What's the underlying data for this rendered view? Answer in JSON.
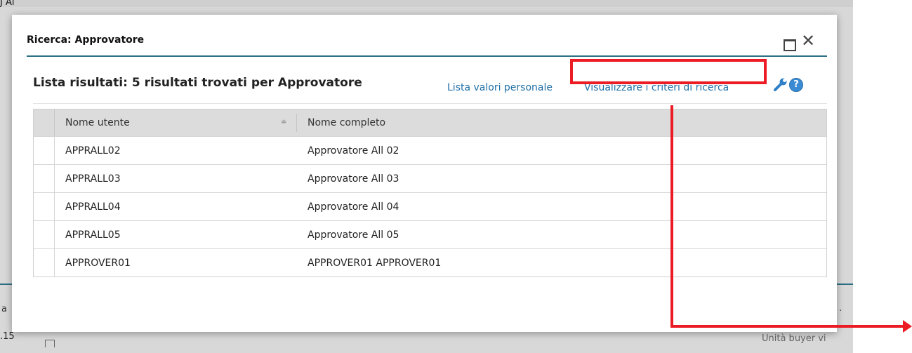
{
  "background": {
    "top_left_text": "J Al",
    "left_mid_text": "a",
    "bottom_left_text": ".15",
    "bottom_right_text": "Unità buyer vi",
    "right_mid_text": "."
  },
  "dialog": {
    "title": "Ricerca: Approvatore",
    "results_title": "Lista risultati: 5 risultati trovati per Approvatore",
    "personal_values_link": "Lista valori personale",
    "search_criteria_link": "Visualizzare i criteri di ricerca",
    "help_glyph": "?",
    "close_glyph": "✕",
    "table": {
      "columns": [
        "Nome utente",
        "Nome completo"
      ],
      "sort_glyph": "≐",
      "rows": [
        [
          "APPRALL02",
          "Approvatore All 02"
        ],
        [
          "APPRALL03",
          "Approvatore All 03"
        ],
        [
          "APPRALL04",
          "Approvatore All 04"
        ],
        [
          "APPRALL05",
          "Approvatore All 05"
        ],
        [
          "APPROVER01",
          "APPROVER01 APPROVER01"
        ]
      ]
    }
  },
  "colors": {
    "accent": "#2b7186",
    "link": "#1f6fa6",
    "annotation": "#ec1c24"
  }
}
